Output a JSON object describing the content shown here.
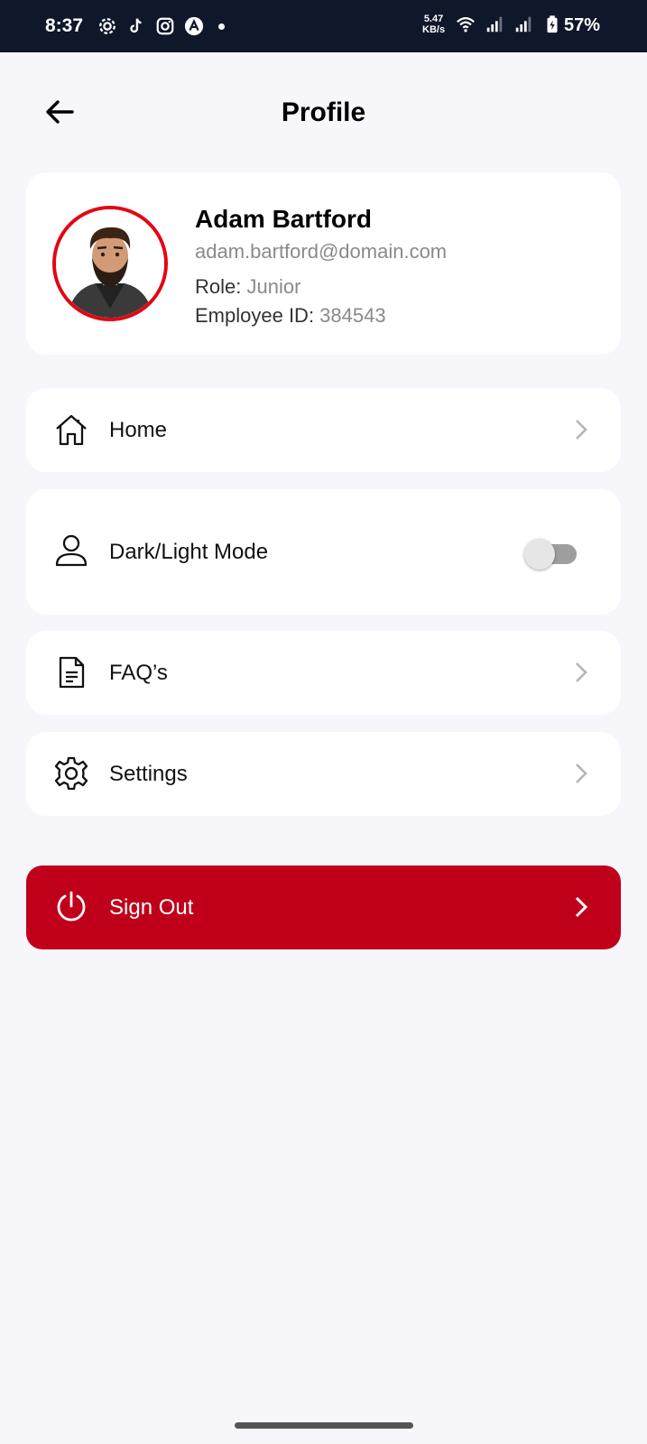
{
  "status_bar": {
    "time": "8:37",
    "speed_value": "5.47",
    "speed_unit": "KB/s",
    "battery": "57%",
    "icons": [
      "settings-icon",
      "tiktok-icon",
      "instagram-icon",
      "app-icon",
      "dot-icon",
      "wifi-icon",
      "signal-icon",
      "signal-icon",
      "battery-charging-icon"
    ]
  },
  "header": {
    "title": "Profile",
    "back_icon": "arrow-left-icon"
  },
  "profile": {
    "name": "Adam Bartford",
    "email": "adam.bartford@domain.com",
    "role_label": "Role: ",
    "role_value": "Junior",
    "id_label": "Employee ID: ",
    "id_value": "384543",
    "avatar_ring_color": "#e30613"
  },
  "menu": {
    "home": {
      "label": "Home",
      "icon": "home-icon"
    },
    "mode": {
      "label": "Dark/Light Mode",
      "icon": "user-icon",
      "toggle_on": false
    },
    "faq": {
      "label": "FAQ’s",
      "icon": "document-icon"
    },
    "settings": {
      "label": "Settings",
      "icon": "gear-icon"
    }
  },
  "signout": {
    "label": "Sign Out",
    "icon": "power-icon",
    "color": "#c0001a"
  }
}
